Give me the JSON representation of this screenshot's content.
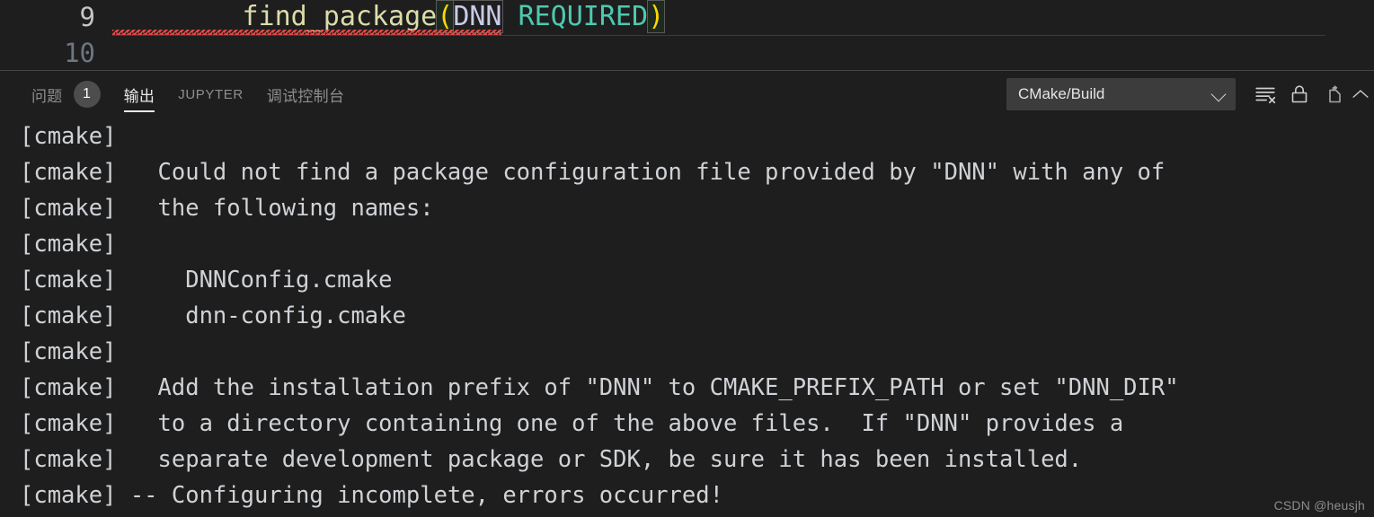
{
  "editor": {
    "lines": [
      {
        "number": "9",
        "active": true,
        "tokens": [
          {
            "text": "find_package",
            "kind": "word"
          },
          {
            "text": "(",
            "kind": "paren"
          },
          {
            "text": "DNN",
            "kind": "arg"
          },
          {
            "text": " ",
            "kind": "plain"
          },
          {
            "text": "REQUIRED",
            "kind": "kw"
          },
          {
            "text": ")",
            "kind": "paren"
          }
        ],
        "has_error_squiggle": true
      },
      {
        "number": "10",
        "active": false,
        "tokens": [],
        "has_error_squiggle": false
      }
    ]
  },
  "panel": {
    "tabs": [
      {
        "label": "问题",
        "badge": "1",
        "active": false,
        "latin": false
      },
      {
        "label": "输出",
        "badge": null,
        "active": true,
        "latin": false
      },
      {
        "label": "JUPYTER",
        "badge": null,
        "active": false,
        "latin": true
      },
      {
        "label": "调试控制台",
        "badge": null,
        "active": false,
        "latin": false
      }
    ],
    "channel": {
      "selected": "CMake/Build",
      "options": [
        "CMake/Build"
      ]
    },
    "actions": [
      {
        "name": "clear-output-icon",
        "title": "清除输出"
      },
      {
        "name": "lock-scroll-icon",
        "title": "关闭自动滚动锁定"
      },
      {
        "name": "open-in-editor-icon",
        "title": "在编辑器中打开输出"
      },
      {
        "name": "chevron-up-icon",
        "title": "最大化面板大小"
      }
    ]
  },
  "output": {
    "lines": [
      "[cmake]",
      "[cmake]   Could not find a package configuration file provided by \"DNN\" with any of",
      "[cmake]   the following names:",
      "[cmake]",
      "[cmake]     DNNConfig.cmake",
      "[cmake]     dnn-config.cmake",
      "[cmake]",
      "[cmake]   Add the installation prefix of \"DNN\" to CMAKE_PREFIX_PATH or set \"DNN_DIR\"",
      "[cmake]   to a directory containing one of the above files.  If \"DNN\" provides a",
      "[cmake]   separate development package or SDK, be sure it has been installed.",
      "[cmake] -- Configuring incomplete, errors occurred!"
    ]
  },
  "watermark": {
    "text": "CSDN @heusjh"
  },
  "colors": {
    "editor_background": "#1e1e1e",
    "function_token": "#dcdcaa",
    "paren_token": "#ffd702",
    "argument_token": "#c8cbe8",
    "keyword_token": "#4ec9b0",
    "error_squiggle": "#f14c4c",
    "output_text": "#cfd2d6",
    "active_tab_text": "#e7e7e7",
    "inactive_tab_text": "#8e8e8e",
    "select_background": "#3c3c3c",
    "divider": "#454545"
  }
}
